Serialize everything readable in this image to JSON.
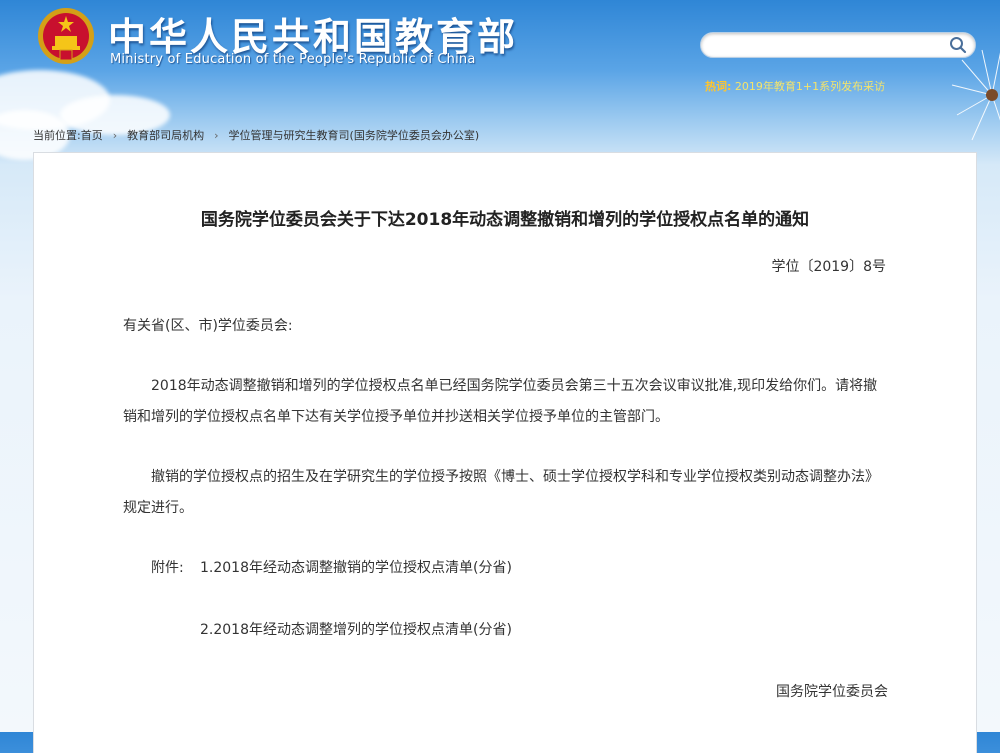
{
  "header": {
    "title_cn": "中华人民共和国教育部",
    "title_en": "Ministry of Education of the People's Republic of China",
    "search_placeholder": "",
    "hot_label": "热词:",
    "hot_text": "2019年教育1+1系列发布采访"
  },
  "breadcrumb": {
    "prefix": "当前位置:",
    "items": [
      "首页",
      "教育部司局机构",
      "学位管理与研究生教育司(国务院学位委员会办公室)"
    ]
  },
  "document": {
    "title": "国务院学位委员会关于下达2018年动态调整撤销和增列的学位授权点名单的通知",
    "number": "学位〔2019〕8号",
    "salutation": "有关省(区、市)学位委员会:",
    "para1": "2018年动态调整撤销和增列的学位授权点名单已经国务院学位委员会第三十五次会议审议批准,现印发给你们。请将撤销和增列的学位授权点名单下达有关学位授予单位并抄送相关学位授予单位的主管部门。",
    "para2": "撤销的学位授权点的招生及在学研究生的学位授予按照《博士、硕士学位授权学科和专业学位授权类别动态调整办法》规定进行。",
    "attach_label": "附件:",
    "attachments": [
      "1.2018年经动态调整撤销的学位授权点清单(分省)",
      "2.2018年经动态调整增列的学位授权点清单(分省)"
    ],
    "signer": "国务院学位委员会"
  },
  "colors": {
    "accent_link": "#1e2f9e",
    "header_blue": "#2f86d6",
    "hot_label": "#ffc52e"
  }
}
